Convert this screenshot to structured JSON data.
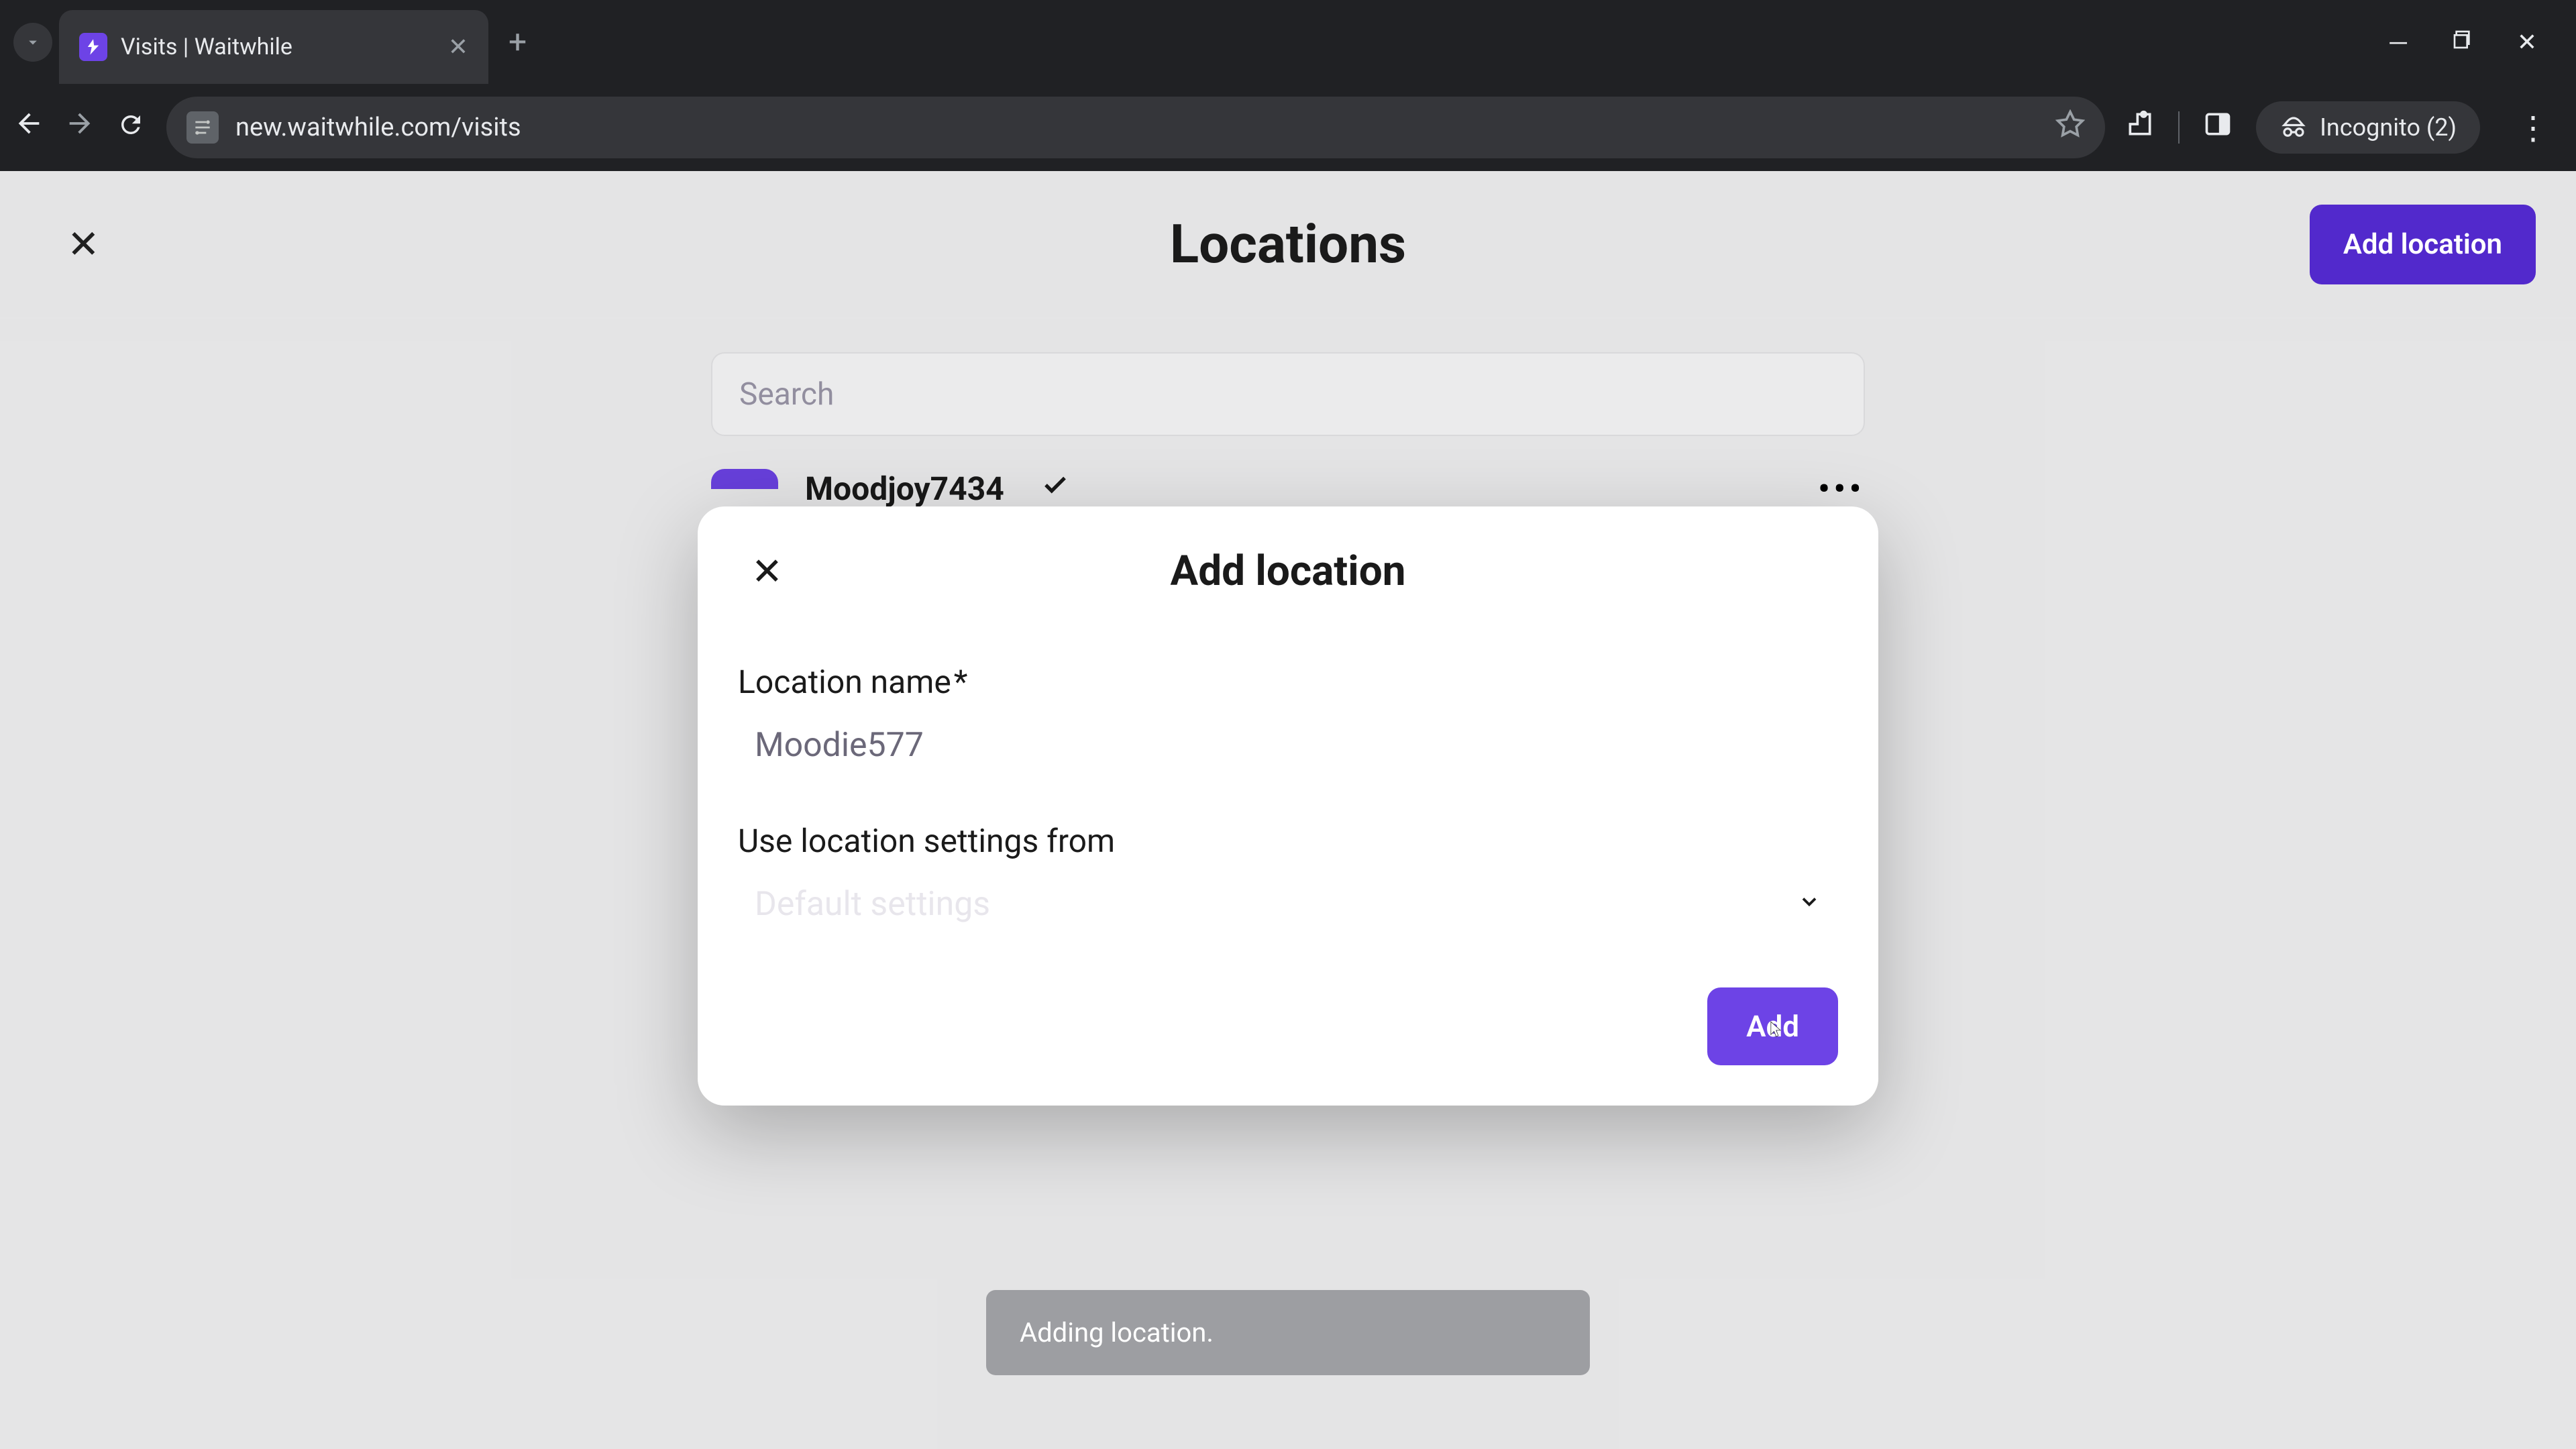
{
  "browser": {
    "tab_title": "Visits | Waitwhile",
    "url": "new.waitwhile.com/visits",
    "incognito_label": "Incognito (2)"
  },
  "page": {
    "title": "Locations",
    "add_location_button": "Add location",
    "search_placeholder": "Search",
    "location": {
      "name": "Moodjoy7434"
    }
  },
  "modal": {
    "title": "Add location",
    "location_name_label": "Location name",
    "required_marker": "*",
    "location_name_value": "Moodie577",
    "settings_from_label": "Use location settings from",
    "settings_placeholder": "Default settings",
    "add_button": "Add"
  },
  "toast": {
    "message": "Adding location."
  },
  "colors": {
    "primary": "#6d43e6",
    "primary_dark": "#5229cc"
  }
}
